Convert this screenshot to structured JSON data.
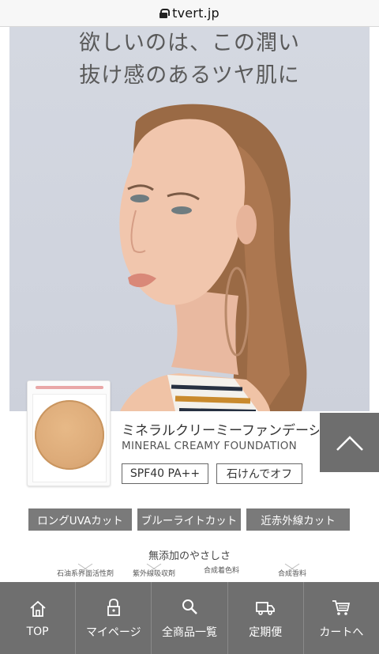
{
  "browser": {
    "url": "tvert.jp"
  },
  "hero": {
    "title_line1": "欲しいのは、この潤い",
    "title_line2": "抜け感のあるツヤ肌に"
  },
  "product": {
    "name_jp": "ミネラルクリーミーファンデーシ",
    "name_en": "MINERAL CREAMY FOUNDATION",
    "tags": [
      "SPF40 PA++",
      "石けんでオフ"
    ]
  },
  "features": [
    "ロングUVAカット",
    "ブルーライトカット",
    "近赤外線カット"
  ],
  "additive": {
    "heading": "無添加のやさしさ",
    "items": [
      "石油系界面活性剤",
      "紫外線吸収剤",
      "合成着色料",
      "合成香料"
    ]
  },
  "bottom_nav": [
    {
      "label": "TOP",
      "icon": "home-icon"
    },
    {
      "label": "マイページ",
      "icon": "lock-icon"
    },
    {
      "label": "全商品一覧",
      "icon": "search-icon"
    },
    {
      "label": "定期便",
      "icon": "truck-icon"
    },
    {
      "label": "カートへ",
      "icon": "cart-icon"
    }
  ],
  "colors": {
    "hero_bg": "#d2d6df",
    "nav_bg": "#6f6f6f",
    "feature_bg": "#7a7a7a",
    "scroll_top_bg": "#6e6e6e"
  }
}
